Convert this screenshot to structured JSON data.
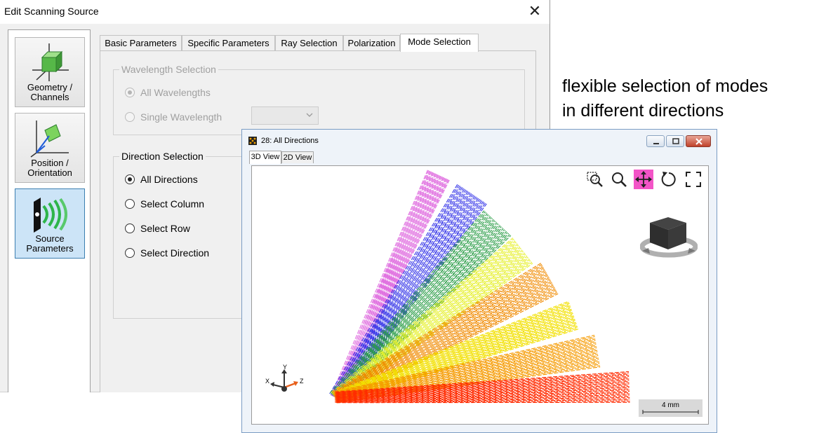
{
  "dialog": {
    "title": "Edit Scanning Source",
    "nav": [
      {
        "label": "Geometry /\nChannels",
        "selected": false
      },
      {
        "label": "Position /\nOrientation",
        "selected": false
      },
      {
        "label": "Source\nParameters",
        "selected": true
      }
    ],
    "tabs": [
      {
        "label": "Basic Parameters",
        "active": false
      },
      {
        "label": "Specific Parameters",
        "active": false
      },
      {
        "label": "Ray Selection",
        "active": false
      },
      {
        "label": "Polarization",
        "active": false
      },
      {
        "label": "Mode Selection",
        "active": true
      }
    ],
    "wavelength_group": {
      "legend": "Wavelength Selection",
      "options": [
        {
          "label": "All Wavelengths",
          "checked": true
        },
        {
          "label": "Single Wavelength",
          "checked": false
        }
      ]
    },
    "direction_group": {
      "legend": "Direction Selection",
      "options": [
        {
          "label": "All Directions",
          "checked": true
        },
        {
          "label": "Select Column",
          "checked": false
        },
        {
          "label": "Select Row",
          "checked": false
        },
        {
          "label": "Select Direction",
          "checked": false
        }
      ]
    }
  },
  "annotation": {
    "line1": "flexible selection of modes",
    "line2": "in different directions"
  },
  "view_window": {
    "title": "28: All Directions",
    "tabs": [
      {
        "label": "3D View",
        "active": true
      },
      {
        "label": "2D View",
        "active": false
      }
    ],
    "tools": [
      {
        "name": "zoom-window-icon",
        "active": false
      },
      {
        "name": "zoom-icon",
        "active": false
      },
      {
        "name": "pan-icon",
        "active": true
      },
      {
        "name": "rotate-icon",
        "active": false
      },
      {
        "name": "fit-view-icon",
        "active": false
      }
    ],
    "axes": {
      "x": "X",
      "y": "Y",
      "z": "Z"
    },
    "scale_bar_label": "4 mm",
    "ray_colors": [
      "#e070e0",
      "#3a3ae8",
      "#2e9e4a",
      "#e6f030",
      "#f08a00",
      "#f2e000",
      "#f59a00",
      "#ff2a00"
    ],
    "colors": {
      "pan_tool_active": "#f354c7",
      "selected_nav": "#cce4f7"
    }
  }
}
